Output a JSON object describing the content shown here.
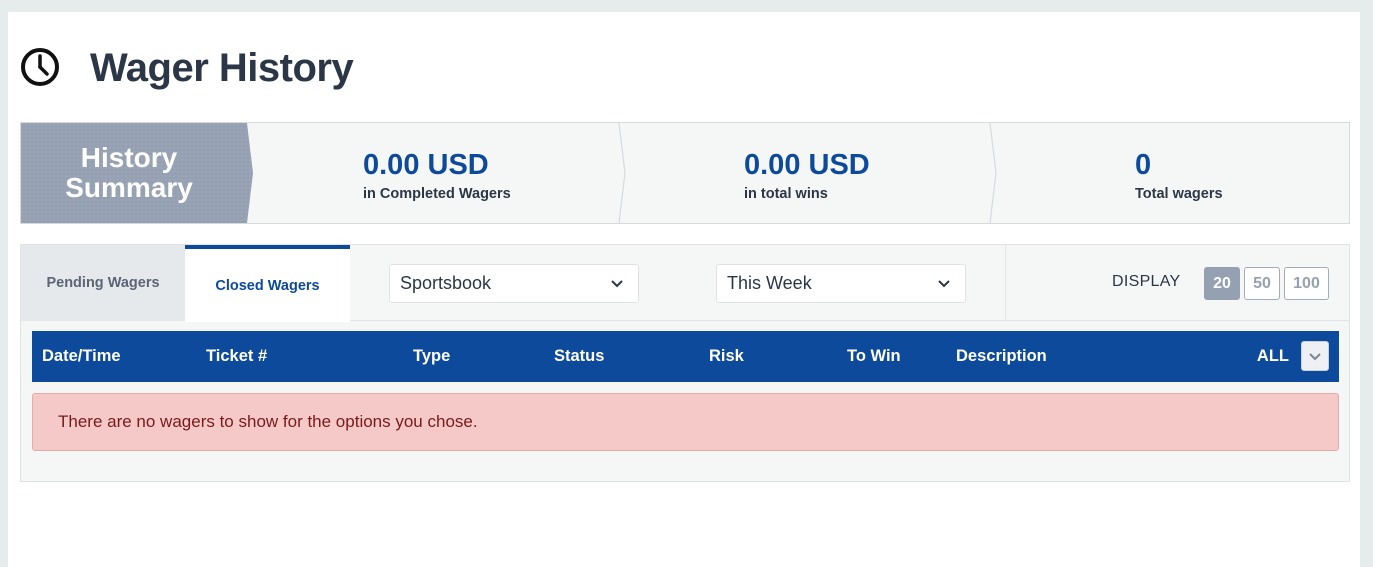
{
  "header": {
    "title": "Wager History",
    "icon": "clock-icon"
  },
  "summary": {
    "label_line1": "History",
    "label_line2": "Summary",
    "stats": [
      {
        "value": "0.00 USD",
        "caption": "in Completed Wagers"
      },
      {
        "value": "0.00 USD",
        "caption": "in total wins"
      },
      {
        "value": "0",
        "caption": "Total wagers"
      }
    ]
  },
  "tabs": [
    {
      "label": "Pending Wagers",
      "active": false
    },
    {
      "label": "Closed Wagers",
      "active": true
    }
  ],
  "filters": {
    "product": {
      "selected": "Sportsbook"
    },
    "period": {
      "selected": "This Week"
    }
  },
  "display": {
    "label": "DISPLAY",
    "options": [
      "20",
      "50",
      "100"
    ],
    "selected": "20"
  },
  "table": {
    "columns": [
      "Date/Time",
      "Ticket #",
      "Type",
      "Status",
      "Risk",
      "To Win",
      "Description"
    ],
    "filter_label": "ALL"
  },
  "empty_message": "There are no wagers to show for the options you chose.",
  "colors": {
    "brand_blue": "#0d4a9b",
    "summary_label_bg": "#95a0b2",
    "alert_bg": "#f4c9c8",
    "alert_text": "#7a1a1a"
  }
}
